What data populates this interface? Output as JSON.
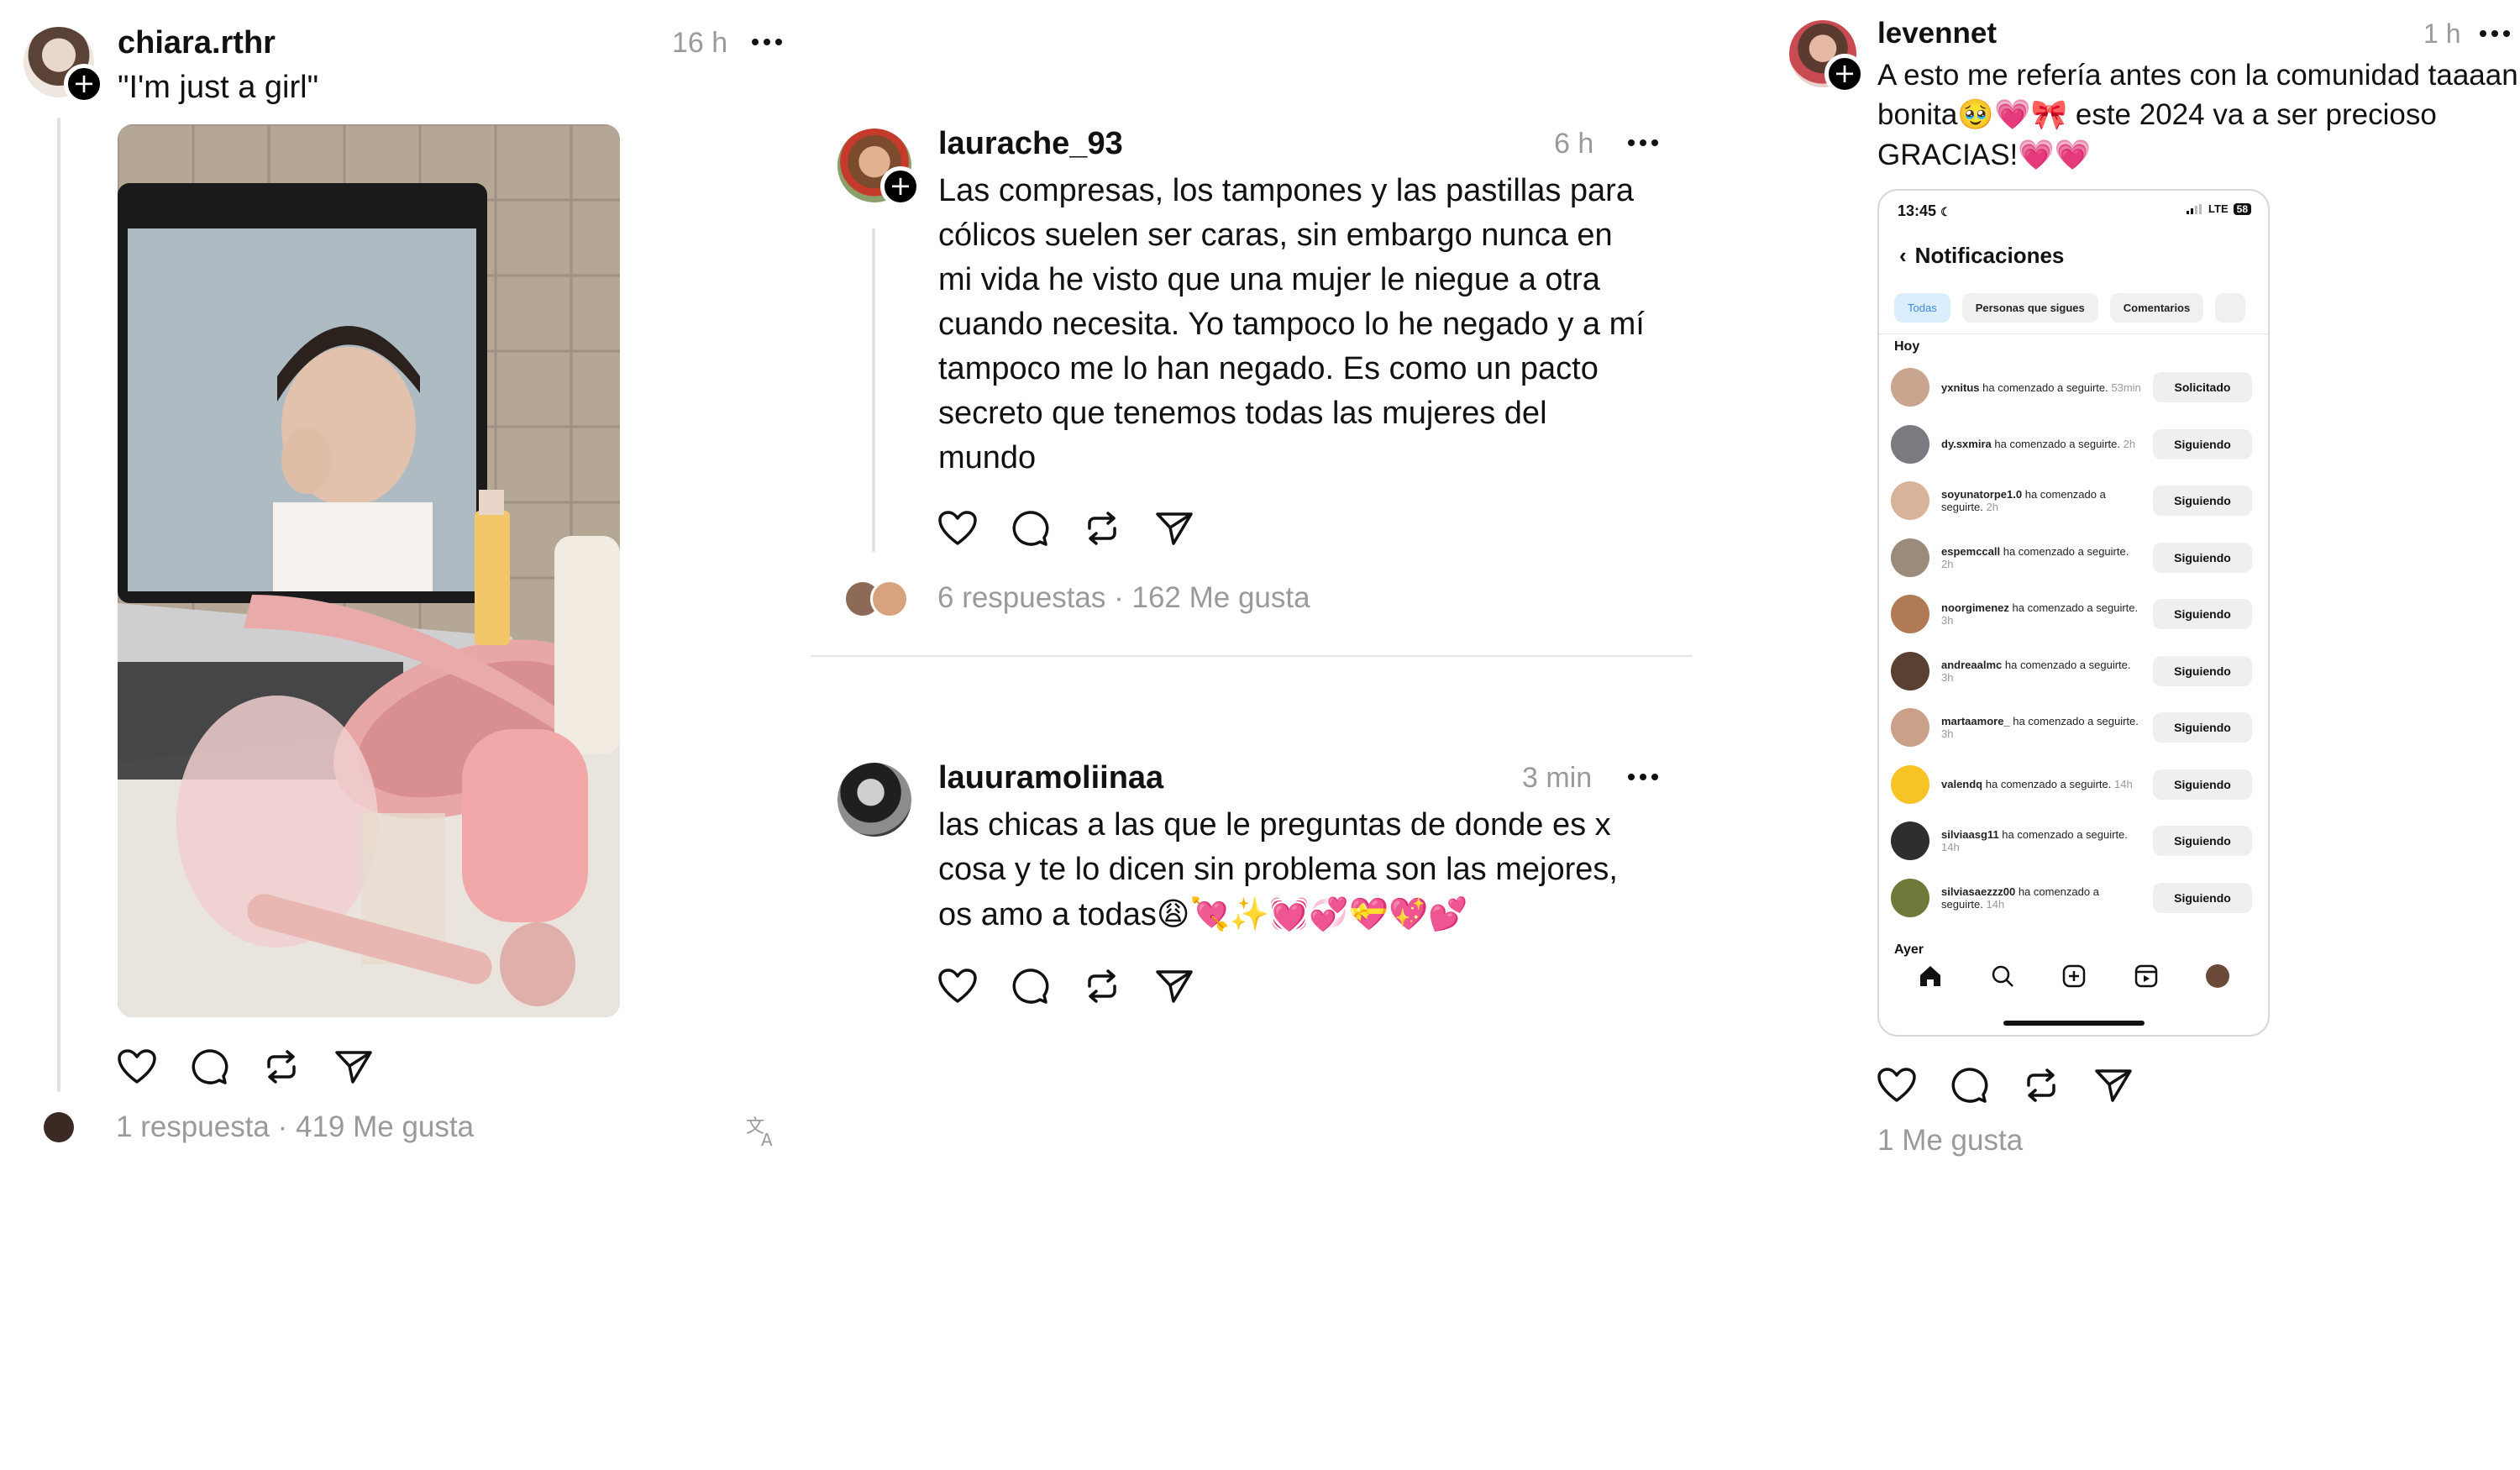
{
  "post1": {
    "username": "chiara.rthr",
    "time": "16 h",
    "text": "\"I'm just a girl\"",
    "stats": "1 respuesta · 419 Me gusta"
  },
  "post2": {
    "username": "laurache_93",
    "time": "6 h",
    "lines": [
      "Las compresas, los tampones y las pastillas para",
      "cólicos suelen ser caras, sin embargo nunca en",
      "mi vida he visto que una mujer le niegue a otra",
      "cuando necesita. Yo tampoco lo he negado y a mí",
      "tampoco me lo han negado. Es como un pacto",
      "secreto que tenemos todas las mujeres del",
      "mundo"
    ],
    "stats": "6 respuestas · 162 Me gusta"
  },
  "post3": {
    "username": "lauuramoliinaa",
    "time": "3 min",
    "lines": [
      "las chicas a las que le preguntas de donde es x",
      "cosa y te lo dicen sin problema son las mejores,",
      "os amo a todas"
    ],
    "emojis": "😩💘✨💓💞💝💖💕"
  },
  "post4": {
    "username": "levennet",
    "time": "1 h",
    "line1": "A esto me refería antes con la comunidad taaaan",
    "line2": "bonita",
    "line2_emojis": "🥹💗🎀",
    "line2_rest": " este 2024 va a ser precioso",
    "line3": "GRACIAS!",
    "line3_emojis": "💗💗",
    "stats": "1 Me gusta"
  },
  "phone": {
    "time": "13:45",
    "network": "LTE",
    "battery": "58",
    "title": "Notificaciones",
    "chips": [
      "Todas",
      "Personas que sigues",
      "Comentarios"
    ],
    "section_today": "Hoy",
    "section_yesterday": "Ayer",
    "rows": [
      {
        "user": "yxnitus",
        "action": "ha comenzado a seguirte.",
        "time": "53min",
        "button": "Solicitado",
        "color": "#c9a48f"
      },
      {
        "user": "dy.sxmira",
        "action": "ha comenzado a seguirte.",
        "time": "2h",
        "button": "Siguiendo",
        "color": "#7a7a80"
      },
      {
        "user": "soyunatorpe1.0",
        "action": "ha comenzado a seguirte.",
        "time": "2h",
        "button": "Siguiendo",
        "color": "#d8b39a"
      },
      {
        "user": "espemccall",
        "action": "ha comenzado a seguirte.",
        "time": "2h",
        "button": "Siguiendo",
        "color": "#9c8a7a"
      },
      {
        "user": "noorgimenez",
        "action": "ha comenzado a seguirte.",
        "time": "3h",
        "button": "Siguiendo",
        "color": "#b07a55"
      },
      {
        "user": "andreaalmc",
        "action": "ha comenzado a seguirte.",
        "time": "3h",
        "button": "Siguiendo",
        "color": "#5a4030"
      },
      {
        "user": "martaamore_",
        "action": "ha comenzado a seguirte.",
        "time": "3h",
        "button": "Siguiendo",
        "color": "#caa088"
      },
      {
        "user": "valendq",
        "action": "ha comenzado a seguirte.",
        "time": "14h",
        "button": "Siguiendo",
        "color": "#f7c325"
      },
      {
        "user": "silviaasg11",
        "action": "ha comenzado a seguirte.",
        "time": "14h",
        "button": "Siguiendo",
        "color": "#2e2e2e"
      },
      {
        "user": "silviasaezzz00",
        "action": "ha comenzado a seguirte.",
        "time": "14h",
        "button": "Siguiendo",
        "color": "#6d7a3a"
      }
    ]
  },
  "colors": {
    "muted": "#9a9a9a",
    "thread_line": "#e0e0e0",
    "chip_active": "#3a8ae0"
  }
}
